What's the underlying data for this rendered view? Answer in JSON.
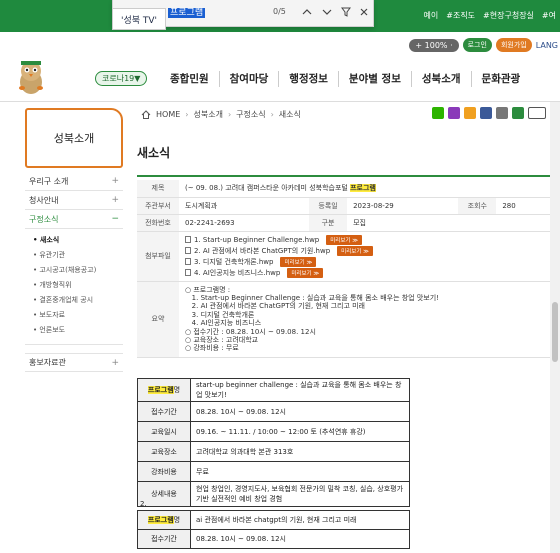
{
  "findbar": {
    "tab_label": "'성북 TV'",
    "query": "프로그램",
    "count": "0/5",
    "prev_icon": "chevron-up-icon",
    "next_icon": "chevron-down-icon",
    "filter_icon": "filter-icon",
    "close_icon": "close-icon"
  },
  "top_keywords": [
    "예이",
    "#조직도",
    "#현장구청장실",
    "#여"
  ],
  "utility": {
    "zoom": "+ 100% ·",
    "login": "로그인",
    "signup": "회원가입",
    "lang": "LANG"
  },
  "header": {
    "covid_label": "코로나19▼",
    "nav": [
      "종합민원",
      "참여마당",
      "행정정보",
      "분야별 정보",
      "성북소개",
      "문화관광"
    ]
  },
  "sidebar": {
    "title": "성북소개",
    "items": [
      {
        "label": "우리구 소개",
        "pm": "+"
      },
      {
        "label": "청사안내",
        "pm": "+"
      },
      {
        "label": "구정소식",
        "pm": "−",
        "active": true
      }
    ],
    "sub_items": [
      "새소식",
      "유관기관",
      "고시공고(채용공고)",
      "개방형직위",
      "결혼중개업체 공시",
      "보도자료",
      "언론보도"
    ],
    "last_item": {
      "label": "홍보자료관",
      "pm": "+"
    }
  },
  "breadcrumb": [
    "HOME",
    "성북소개",
    "구정소식",
    "새소식"
  ],
  "page_title": "새소식",
  "post": {
    "subject_label": "제목",
    "subject_prefix": "(~ 09. 08.) 고려대 캠퍼스타운 아카데미 성북학습포털 ",
    "subject_highlight": "프로그램",
    "dept_label": "주관부서",
    "dept": "도시계획과",
    "date_label": "등록일",
    "date": "2023-08-29",
    "views_label": "조회수",
    "views": "280",
    "phone_label": "전화번호",
    "phone": "02-2241-2693",
    "type_label": "구분",
    "type": "모집",
    "files_label": "첨부파일",
    "files": [
      "1. Start-up Beginner Challenge.hwp",
      "2. AI 관점에서 바라본 ChatGPT의 기원.hwp",
      "3. 디지털 건축학개론.hwp",
      "4. AI인공지능 비즈니스.hwp"
    ],
    "preview_label": "미리보기 ≫",
    "summary_label": "요약",
    "summary_lines": [
      "○ 프로그램명 :",
      "   1. Start-up Beginner Challenge : 실습과 교육을 통해 몸소 배우는 창업 맛보기!",
      "   2. AI 관점에서 바라본 ChatGPT의 기원, 현재 그리고 미래",
      "   3. 디지털 건축학개론",
      "   4. AI인공지능 비즈니스",
      "○ 접수기간 : 08.28. 10시 ~ 09.08. 12시",
      "○ 교육장소 : 고려대학교",
      "○ 강좌비용 : 무료"
    ]
  },
  "detail1": {
    "program_key_hl": "프로그램",
    "program_key_suffix": "명",
    "program_value": "start-up beginner challenge : 실습과 교육을 통해 몸소 배우는 창업 맛보기!",
    "rows": [
      {
        "k": "접수기간",
        "v": "08.28. 10시 ~ 09.08. 12시"
      },
      {
        "k": "교육일시",
        "v": "09.16. ~ 11.11. / 10:00 ~ 12:00 토 (추석연휴 휴강)"
      },
      {
        "k": "교육장소",
        "v": "고려대학교 의과대학 본관 313호"
      },
      {
        "k": "강좌비용",
        "v": "무료"
      },
      {
        "k": "상세내용",
        "v": "현업 창업인, 경영지도사, 보육협회 전문가의 밀착 코칭, 실습, 상호평가 기반 실전적인 예비 창업 경험"
      }
    ]
  },
  "detail2": {
    "number": "2.",
    "program_key_hl": "프로그램",
    "program_key_suffix": "명",
    "program_value": "ai 관점에서 바라본 chatgpt의 기원, 현재 그리고 미래",
    "rows": [
      {
        "k": "접수기간",
        "v": "08.28. 10시 ~ 09.08. 12시"
      }
    ]
  },
  "colors": {
    "brand_green": "#1f8a3e",
    "accent_orange": "#e07a22",
    "highlight_yellow": "#ffec3d",
    "find_selection": "#1a5fd1"
  }
}
